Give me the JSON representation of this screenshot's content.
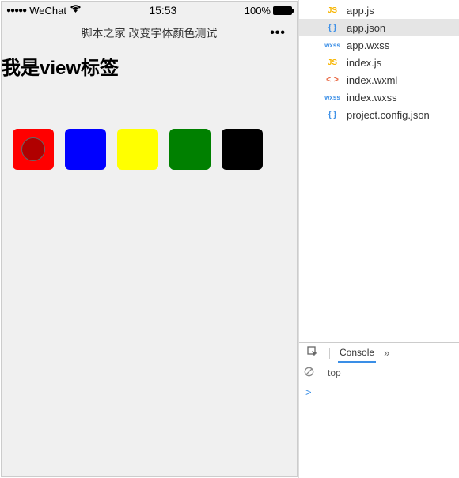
{
  "statusbar": {
    "carrier": "WeChat",
    "time": "15:53",
    "battery": "100%"
  },
  "navbar": {
    "title": "脚本之家 改变字体颜色测试"
  },
  "content": {
    "label": "我是view标签",
    "colors": [
      {
        "name": "red",
        "hex": "#ff0000",
        "selected": true
      },
      {
        "name": "blue",
        "hex": "#0000ff",
        "selected": false
      },
      {
        "name": "yellow",
        "hex": "#ffff00",
        "selected": false
      },
      {
        "name": "green",
        "hex": "#008000",
        "selected": false
      },
      {
        "name": "black",
        "hex": "#000000",
        "selected": false
      }
    ]
  },
  "files": [
    {
      "icon": "JS",
      "icon_cls": "icon-js",
      "name": "app.js",
      "selected": false
    },
    {
      "icon": "{ }",
      "icon_cls": "icon-json",
      "name": "app.json",
      "selected": true
    },
    {
      "icon": "wxss",
      "icon_cls": "icon-wxss",
      "name": "app.wxss",
      "selected": false
    },
    {
      "icon": "JS",
      "icon_cls": "icon-js",
      "name": "index.js",
      "selected": false
    },
    {
      "icon": "< >",
      "icon_cls": "icon-wxml",
      "name": "index.wxml",
      "selected": false
    },
    {
      "icon": "wxss",
      "icon_cls": "icon-wxss",
      "name": "index.wxss",
      "selected": false
    },
    {
      "icon": "{ }",
      "icon_cls": "icon-json",
      "name": "project.config.json",
      "selected": false
    }
  ],
  "console": {
    "tab": "Console",
    "scope": "top",
    "prompt": ">"
  }
}
